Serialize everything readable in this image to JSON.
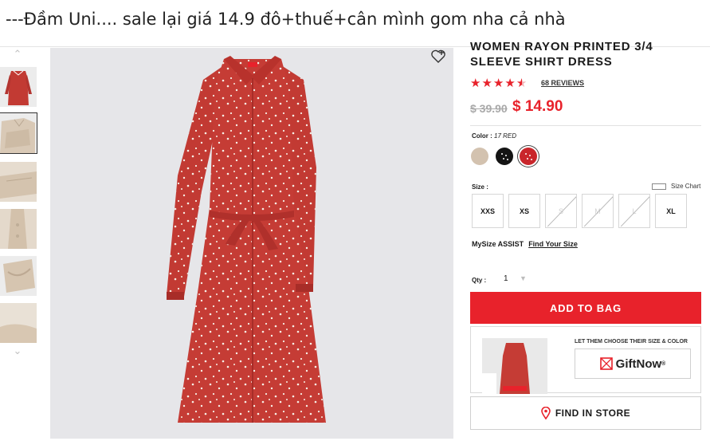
{
  "caption": "---Đầm Uni.... sale lại giá 14.9 đô+thuế+cân mình gom nha cả nhà",
  "product": {
    "title": "WOMEN RAYON PRINTED 3/4 SLEEVE SHIRT DRESS",
    "rating": 4.5,
    "reviews_label": "68 REVIEWS",
    "original_price": "$ 39.90",
    "sale_price": "$ 14.90"
  },
  "color": {
    "label": "Color :",
    "selected": "17 RED",
    "swatches": [
      {
        "name": "beige",
        "hex": "#d3c2af"
      },
      {
        "name": "black",
        "hex": "#141414"
      },
      {
        "name": "red",
        "hex": "#c9262b",
        "selected": true
      }
    ]
  },
  "size": {
    "label": "Size :",
    "chart_label": "Size Chart",
    "options": [
      {
        "label": "XXS",
        "available": true
      },
      {
        "label": "XS",
        "available": true
      },
      {
        "label": "S",
        "available": false
      },
      {
        "label": "M",
        "available": false
      },
      {
        "label": "L",
        "available": false
      },
      {
        "label": "XL",
        "available": true
      }
    ]
  },
  "mysize": {
    "label": "MySize ASSIST",
    "link": "Find Your Size"
  },
  "qty": {
    "label": "Qty :",
    "value": "1"
  },
  "buttons": {
    "add_to_bag": "ADD TO BAG",
    "find_in_store": "FIND IN STORE"
  },
  "gift": {
    "note": "LET THEM CHOOSE THEIR SIZE & COLOR",
    "brand": "GiftNow"
  },
  "colors": {
    "accent": "#e8222b",
    "dress": "#c23a33"
  },
  "icons": [
    "chevron-up-icon",
    "chevron-down-icon",
    "wishlist-heart-icon",
    "star-icon",
    "ruler-icon",
    "chevron-down-icon",
    "giftnow-logo-icon",
    "map-pin-icon"
  ]
}
